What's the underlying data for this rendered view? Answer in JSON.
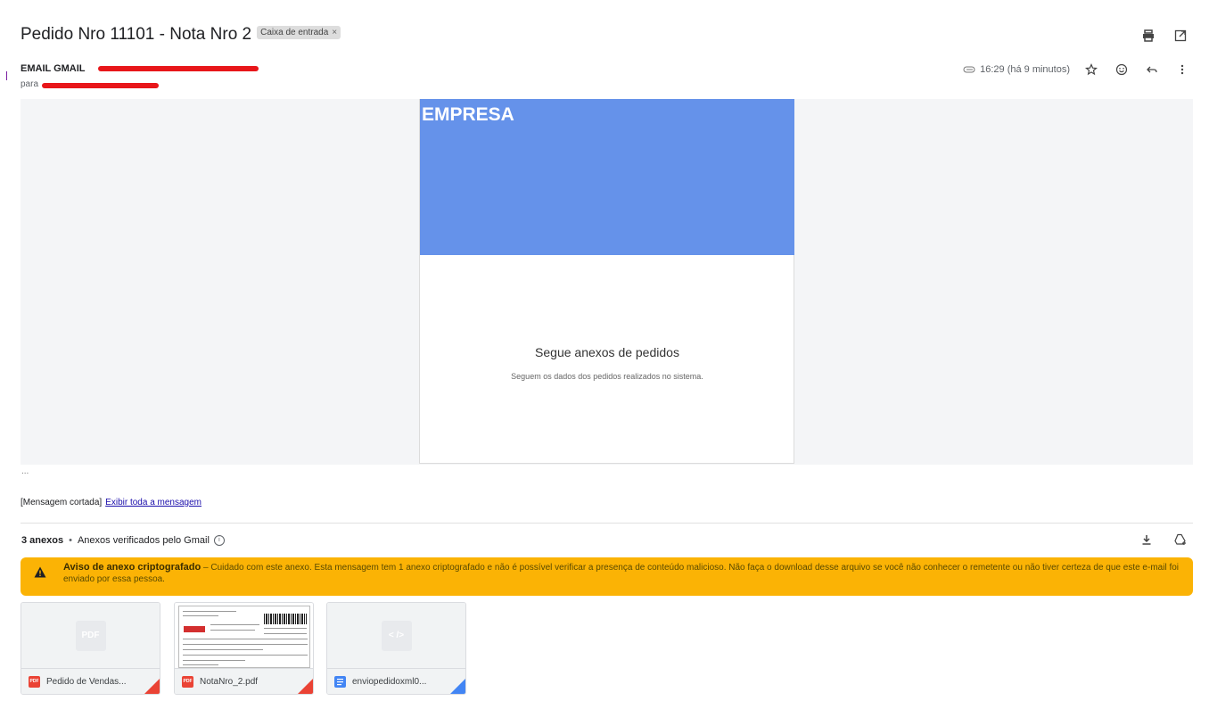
{
  "header": {
    "subject": "Pedido Nro 11101 - Nota Nro 2",
    "label": "Caixa de entrada",
    "label_remove": "×"
  },
  "message": {
    "sender": "EMAIL GMAIL",
    "to_prefix": "para",
    "time": "16:29 (há 9 minutos)"
  },
  "email_body": {
    "company": "EMPRESA",
    "title": "Segue anexos de pedidos",
    "subtitle": "Seguem os dados dos pedidos realizados no sistema.",
    "banner_color": "#6592ea"
  },
  "trimmed": {
    "dots": "...",
    "clipped": "[Mensagem cortada]",
    "show_all": "Exibir toda a mensagem"
  },
  "attachments": {
    "count": "3 anexos",
    "separator": "•",
    "verified": "Anexos verificados pelo Gmail",
    "warning_title": "Aviso de anexo criptografado",
    "warning_text": " – Cuidado com este anexo. Esta mensagem tem 1 anexo criptografado e não é possível verificar a presença de conteúdo malicioso. Não faça o download desse arquivo se você não conhecer o remetente ou não tiver certeza de que este e-mail foi enviado por essa pessoa.",
    "items": [
      {
        "name": "Pedido de Vendas...",
        "type": "PDF",
        "placeholder": "PDF",
        "icon": "pdf-icon"
      },
      {
        "name": "NotaNro_2.pdf",
        "type": "PDF",
        "icon": "pdf-icon"
      },
      {
        "name": "enviopedidoxml0...",
        "type": "DOC",
        "placeholder": "< />",
        "icon": "doc-icon"
      }
    ]
  },
  "colors": {
    "warning": "#fbb305",
    "pdf_red": "#ea4335",
    "doc_blue": "#4285f4"
  }
}
